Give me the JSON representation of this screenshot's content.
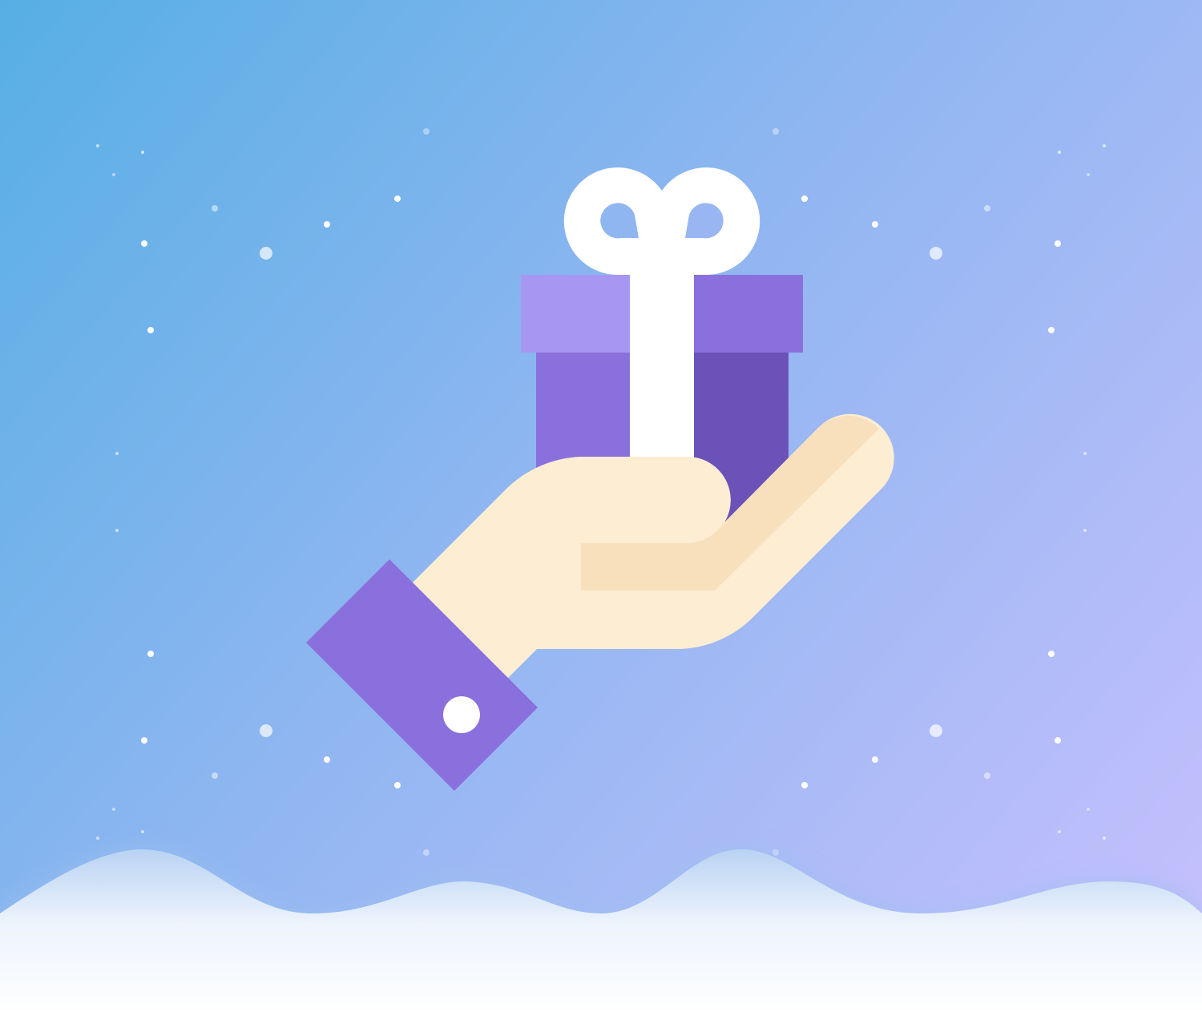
{
  "illustration": {
    "subject": "hand-holding-gift-icon",
    "colors": {
      "background_start": "#56AFE4",
      "background_mid": "#8FB6F1",
      "background_end": "#C8C0FD",
      "gift_lid_light": "#A897F2",
      "gift_lid_dark": "#8A70DC",
      "gift_box_light": "#8A70DC",
      "gift_box_dark": "#6B52B8",
      "ribbon": "#FFFFFF",
      "hand": "#FDEDD2",
      "hand_shadow": "#F9E0BD",
      "sleeve": "#8A70DC",
      "button": "#FFFFFF",
      "snow": "#FFFFFF",
      "snow_shadow": "#A9C8F0",
      "sparkle": "#FFFFFF"
    }
  }
}
